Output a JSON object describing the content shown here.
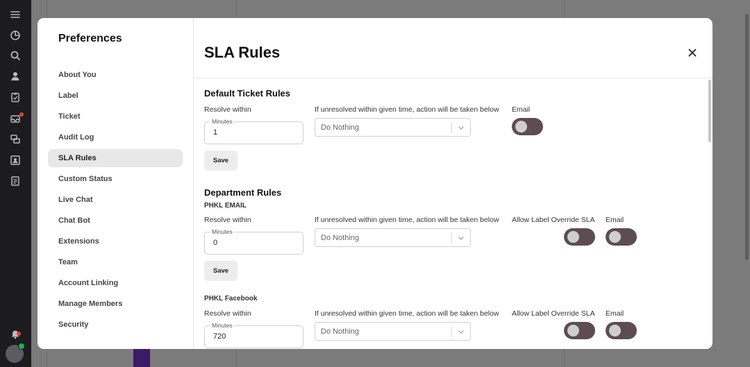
{
  "modal": {
    "sidebar": {
      "title": "Preferences",
      "items": [
        {
          "label": "About You"
        },
        {
          "label": "Label"
        },
        {
          "label": "Ticket"
        },
        {
          "label": "Audit Log"
        },
        {
          "label": "SLA Rules",
          "active": true
        },
        {
          "label": "Custom Status"
        },
        {
          "label": "Live Chat"
        },
        {
          "label": "Chat Bot"
        },
        {
          "label": "Extensions"
        },
        {
          "label": "Team"
        },
        {
          "label": "Account Linking"
        },
        {
          "label": "Manage Members"
        },
        {
          "label": "Security"
        }
      ]
    },
    "main": {
      "title": "SLA Rules",
      "default_rules": {
        "title": "Default Ticket Rules",
        "resolve_label": "Resolve within",
        "minutes_legend": "Minutes",
        "minutes_value": "1",
        "action_label": "If unresolved within given time, action will be taken below",
        "action_value": "Do Nothing",
        "email_label": "Email",
        "save_label": "Save"
      },
      "department_rules": {
        "title": "Department Rules",
        "departments": [
          {
            "name": "PHKL EMAIL",
            "resolve_label": "Resolve within",
            "minutes_legend": "Minutes",
            "minutes_value": "0",
            "action_label": "If unresolved within given time, action will be taken below",
            "action_value": "Do Nothing",
            "override_label": "Allow Label Override SLA",
            "email_label": "Email",
            "save_label": "Save"
          },
          {
            "name": "PHKL Facebook",
            "resolve_label": "Resolve within",
            "minutes_legend": "Minutes",
            "minutes_value": "720",
            "action_label": "If unresolved within given time, action will be taken below",
            "action_value": "Do Nothing",
            "override_label": "Allow Label Override SLA",
            "email_label": "Email"
          }
        ]
      }
    }
  },
  "colors": {
    "toggle_track": "#5d4d52",
    "toggle_knob": "#cfcfcf",
    "rail_bg": "#1c1c1f",
    "notification_dot": "#e0433a",
    "online_dot": "#2fa84f"
  },
  "rail_icons": [
    "menu-icon",
    "analytics-icon",
    "search-icon",
    "user-icon",
    "clipboard-icon",
    "inbox-icon",
    "chat-icon",
    "contacts-icon",
    "reports-icon",
    "notification-bell-icon"
  ]
}
